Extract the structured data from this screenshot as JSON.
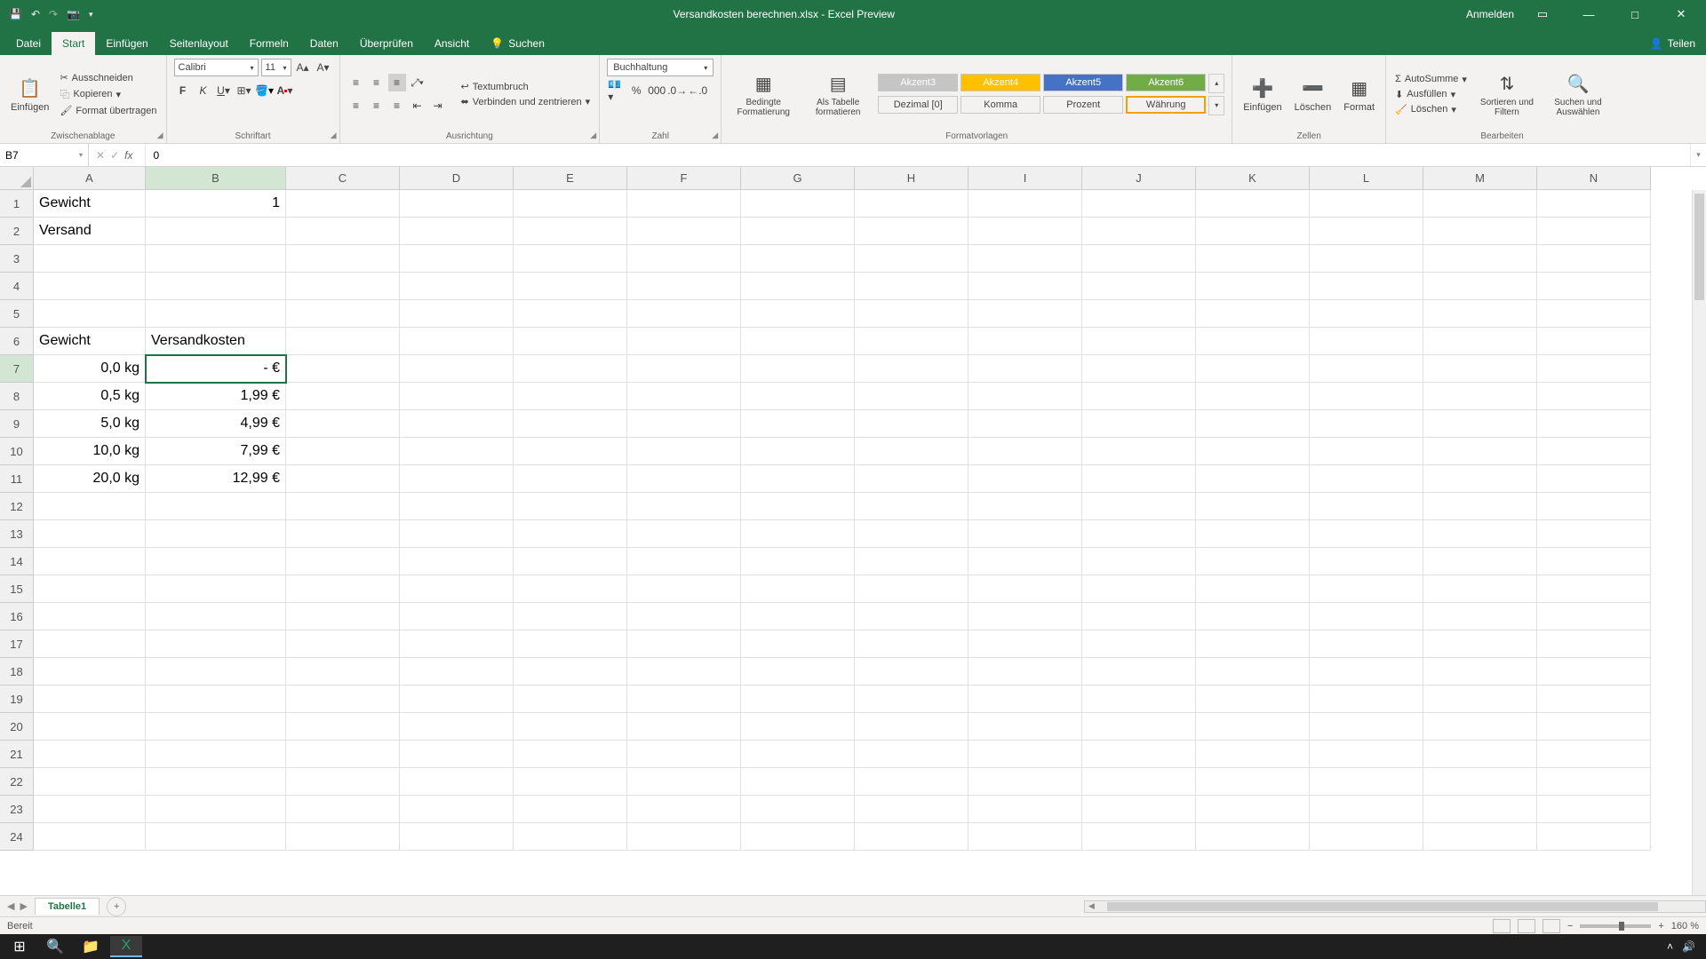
{
  "title": "Versandkosten berechnen.xlsx - Excel Preview",
  "signin": "Anmelden",
  "share": "Teilen",
  "tabs": [
    "Datei",
    "Start",
    "Einfügen",
    "Seitenlayout",
    "Formeln",
    "Daten",
    "Überprüfen",
    "Ansicht"
  ],
  "search": "Suchen",
  "ribbon": {
    "clipboard": {
      "paste": "Einfügen",
      "cut": "Ausschneiden",
      "copy": "Kopieren",
      "format": "Format übertragen",
      "label": "Zwischenablage"
    },
    "font": {
      "name": "Calibri",
      "size": "11",
      "label": "Schriftart"
    },
    "align": {
      "wrap": "Textumbruch",
      "merge": "Verbinden und zentrieren",
      "label": "Ausrichtung"
    },
    "number": {
      "format": "Buchhaltung",
      "label": "Zahl"
    },
    "styles": {
      "cond": "Bedingte Formatierung",
      "table": "Als Tabelle formatieren",
      "a3": "Akzent3",
      "a4": "Akzent4",
      "a5": "Akzent5",
      "a6": "Akzent6",
      "dez": "Dezimal [0]",
      "komma": "Komma",
      "proz": "Prozent",
      "w": "Währung",
      "label": "Formatvorlagen"
    },
    "cells": {
      "ins": "Einfügen",
      "del": "Löschen",
      "fmt": "Format",
      "label": "Zellen"
    },
    "edit": {
      "sum": "AutoSumme",
      "fill": "Ausfüllen",
      "clear": "Löschen",
      "sort": "Sortieren und Filtern",
      "find": "Suchen und Auswählen",
      "label": "Bearbeiten"
    }
  },
  "namebox": "B7",
  "formula": "0",
  "columns": [
    "A",
    "B",
    "C",
    "D",
    "E",
    "F",
    "G",
    "H",
    "I",
    "J",
    "K",
    "L",
    "M",
    "N"
  ],
  "colwidths": {
    "A": 126,
    "B": 158
  },
  "rows": 24,
  "selected": {
    "row": 7,
    "col": "B"
  },
  "data": {
    "A1": "Gewicht",
    "B1": "1",
    "A2": "Versand",
    "A6": "Gewicht",
    "B6": "Versandkosten",
    "A7": "0,0 kg",
    "B7": "-   €",
    "A8": "0,5 kg",
    "B8": "1,99 €",
    "A9": "5,0 kg",
    "B9": "4,99 €",
    "A10": "10,0 kg",
    "B10": "7,99 €",
    "A11": "20,0 kg",
    "B11": "12,99 €"
  },
  "rightAlign": [
    "B1",
    "A7",
    "B7",
    "A8",
    "B8",
    "A9",
    "B9",
    "A10",
    "B10",
    "A11",
    "B11"
  ],
  "sheet": "Tabelle1",
  "status": "Bereit",
  "zoom": "160 %"
}
